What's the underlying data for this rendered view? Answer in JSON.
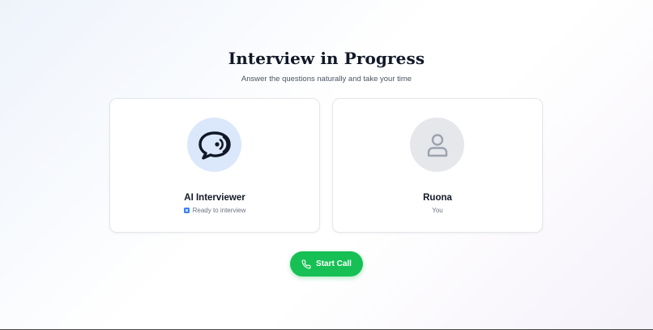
{
  "header": {
    "title": "Interview in Progress",
    "subtitle": "Answer the questions naturally and take your time"
  },
  "participants": [
    {
      "name": "AI Interviewer",
      "status": "Ready to interview",
      "icon": "chat-bubble-icon",
      "status_icon": "status-indicator-icon"
    },
    {
      "name": "Ruona",
      "status": "You",
      "icon": "user-icon"
    }
  ],
  "actions": {
    "start_call_label": "Start Call",
    "start_call_icon": "phone-icon"
  },
  "colors": {
    "accent_green": "#16c054",
    "ai_avatar_bg": "#dbe8fb",
    "user_avatar_bg": "#e5e7eb",
    "status_blue": "#3b82f6"
  }
}
